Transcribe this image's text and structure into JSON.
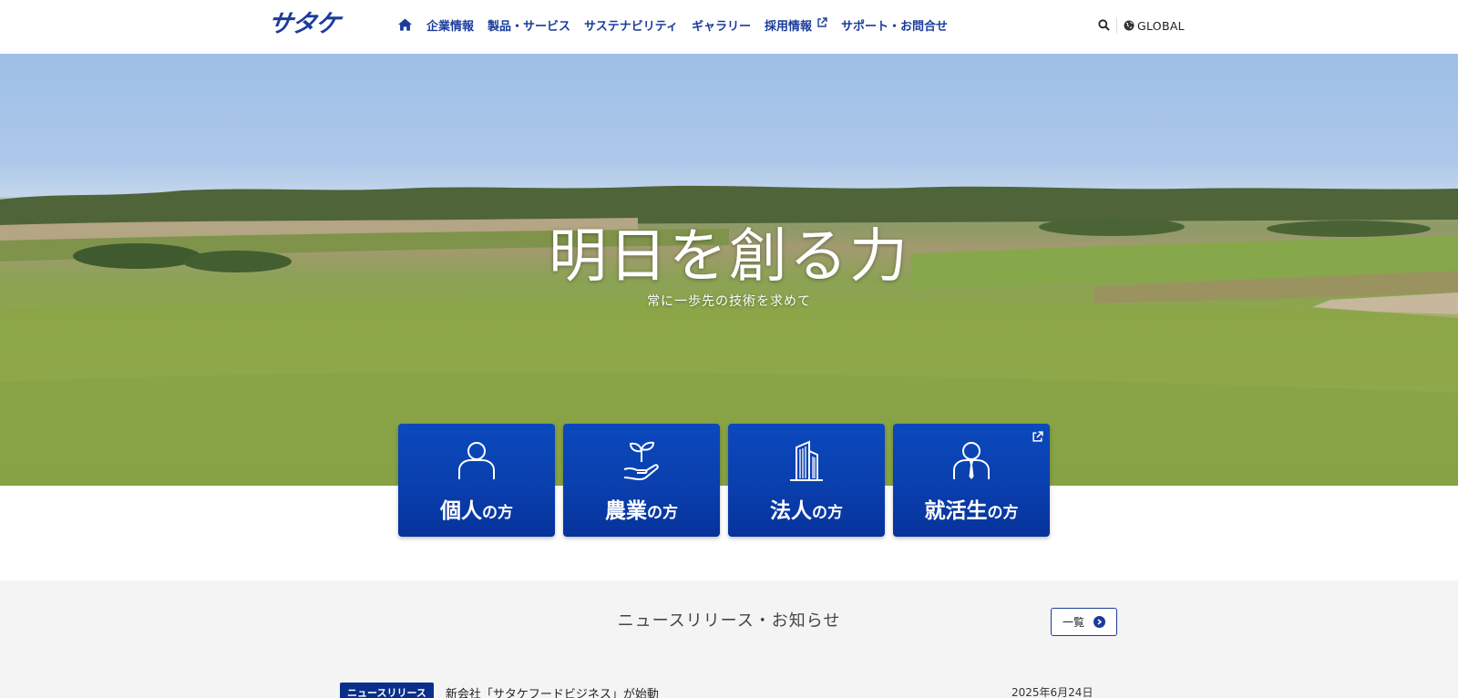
{
  "header": {
    "logo_text": "サタケ",
    "nav": [
      {
        "label": "企業情報"
      },
      {
        "label": "製品・サービス"
      },
      {
        "label": "サステナビリティ"
      },
      {
        "label": "ギャラリー"
      },
      {
        "label": "採用情報",
        "external": true
      },
      {
        "label": "サポート・お問合せ"
      }
    ],
    "home_icon": "home-icon",
    "search_icon": "search-icon",
    "global_label": "GLOBAL",
    "global_icon": "globe-icon"
  },
  "hero": {
    "title": "明日を創る力",
    "subtitle": "常に一歩先の技術を求めて"
  },
  "cards": [
    {
      "label_main": "個人",
      "label_suffix": "の方",
      "icon": "person-icon",
      "external": false
    },
    {
      "label_main": "農業",
      "label_suffix": "の方",
      "icon": "sprout-hand-icon",
      "external": false
    },
    {
      "label_main": "法人",
      "label_suffix": "の方",
      "icon": "building-icon",
      "external": false
    },
    {
      "label_main": "就活生",
      "label_suffix": "の方",
      "icon": "job-seeker-icon",
      "external": true
    }
  ],
  "news": {
    "title": "ニュースリリース・お知らせ",
    "more_label": "一覧",
    "items": [
      {
        "category": "ニュースリリース",
        "headline": "新会社「サタケフードビジネス」が始動",
        "date": "2025年6月24日"
      }
    ]
  },
  "colors": {
    "brand": "#1a3c9c",
    "card_blue": "#0a3fae",
    "news_bg": "#f4f4f4"
  }
}
